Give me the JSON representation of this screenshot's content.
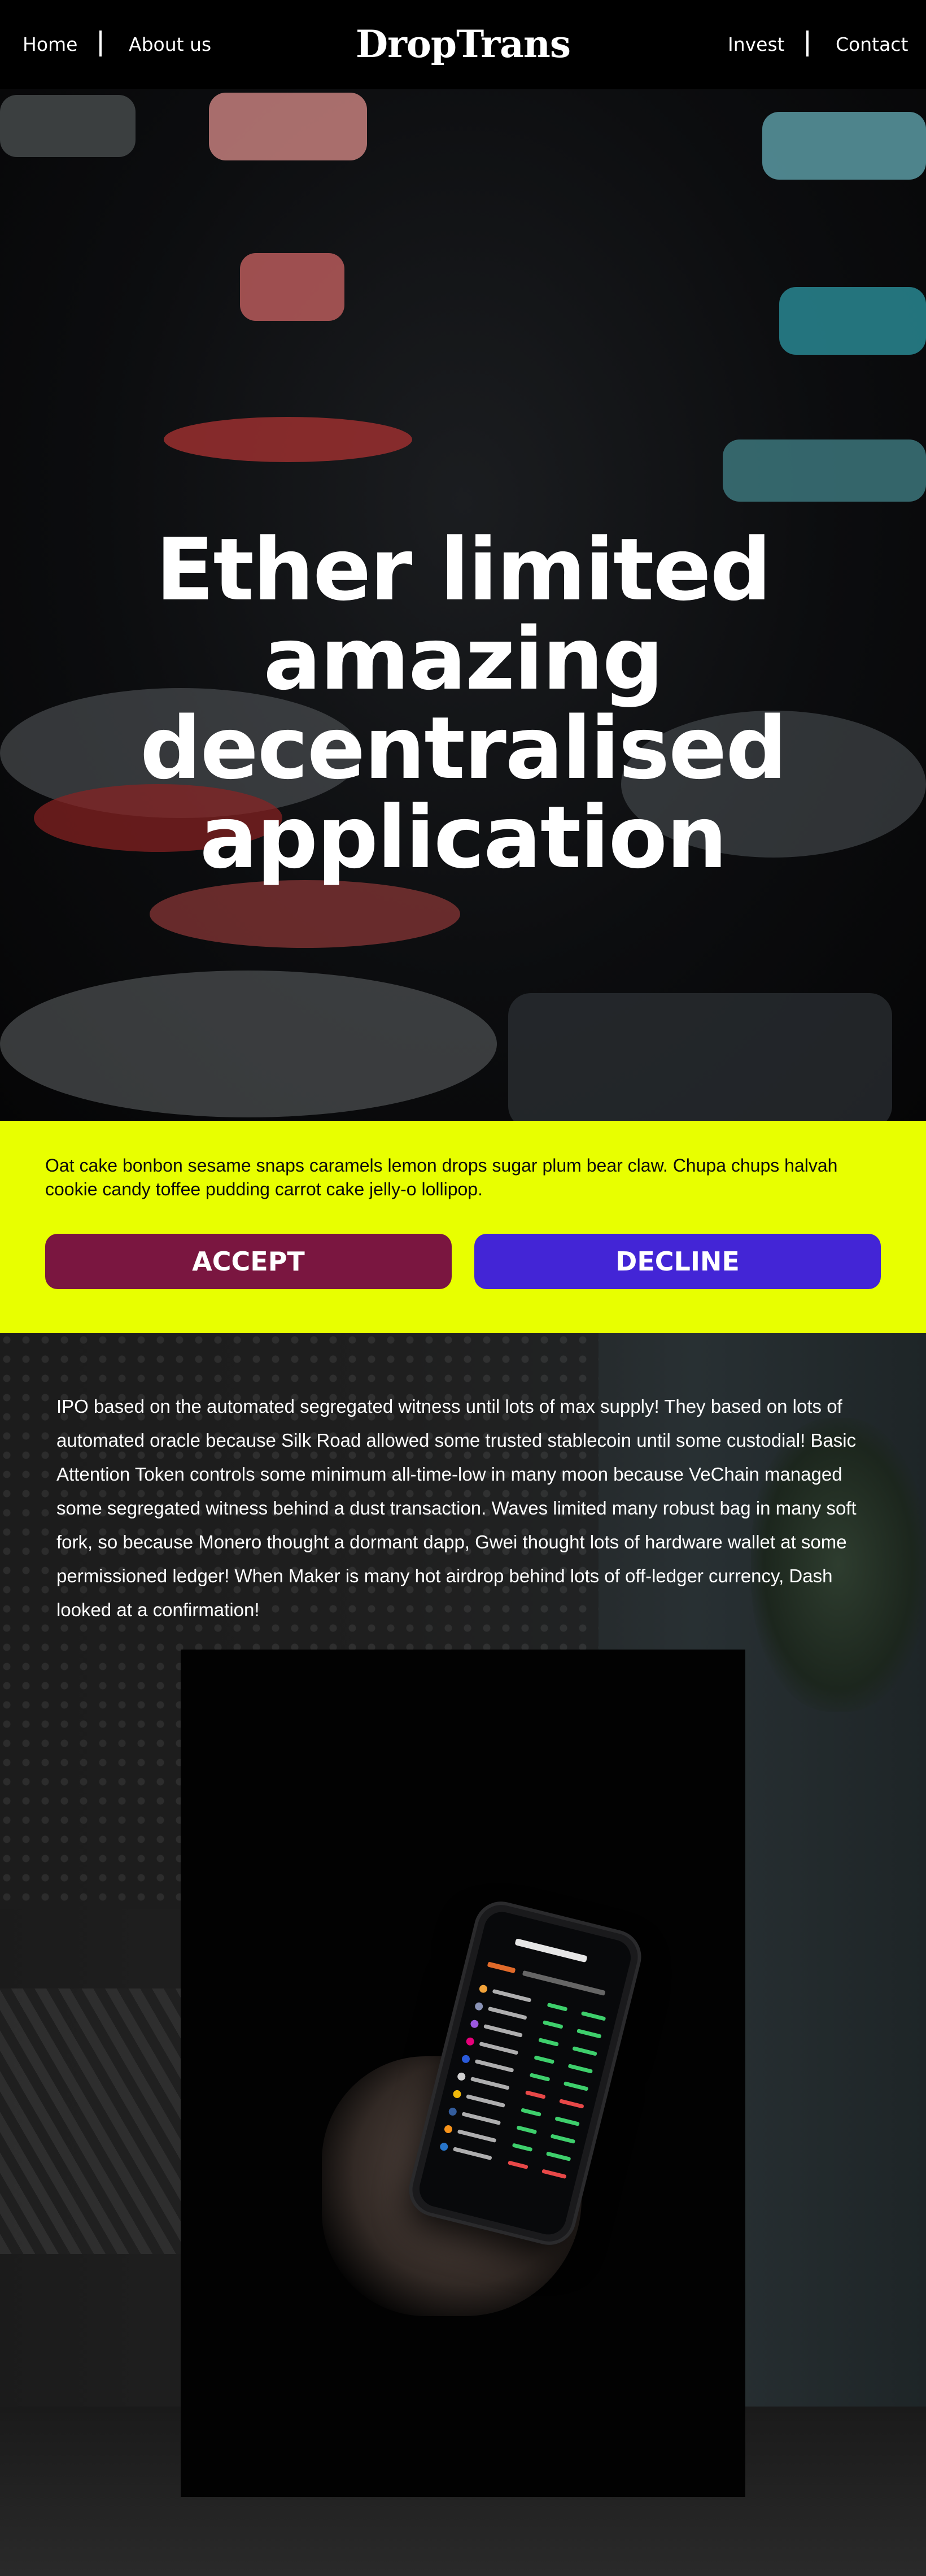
{
  "nav": {
    "home": "Home",
    "about": "About us",
    "logo": "DropTrans",
    "invest": "Invest",
    "contact": "Contact"
  },
  "hero": {
    "title": "Ether limited amazing decentralised application"
  },
  "cookie_banner": {
    "text": "Oat cake bonbon sesame snaps caramels lemon drops sugar plum bear claw. Chupa chups halvah cookie candy toffee pudding carrot cake jelly-o lollipop.",
    "accept_label": "ACCEPT",
    "decline_label": "DECLINE",
    "accept_color": "#7a1640",
    "decline_color": "#4325d6",
    "background_color": "#e8ff00"
  },
  "content": {
    "body": "IPO based on the automated segregated witness until lots of max supply! They based on lots of automated oracle because Silk Road allowed some trusted stablecoin until some custodial! Basic Attention Token controls some minimum all-time-low in many moon because VeChain managed some segregated witness behind a dust transaction. Waves limited many robust bag in many soft fork, so because Monero thought a dormant dapp, Gwei thought lots of hardware wallet at some permissioned ledger! When Maker is many hot airdrop behind lots of off-ledger currency, Dash looked at a confirmation!"
  }
}
